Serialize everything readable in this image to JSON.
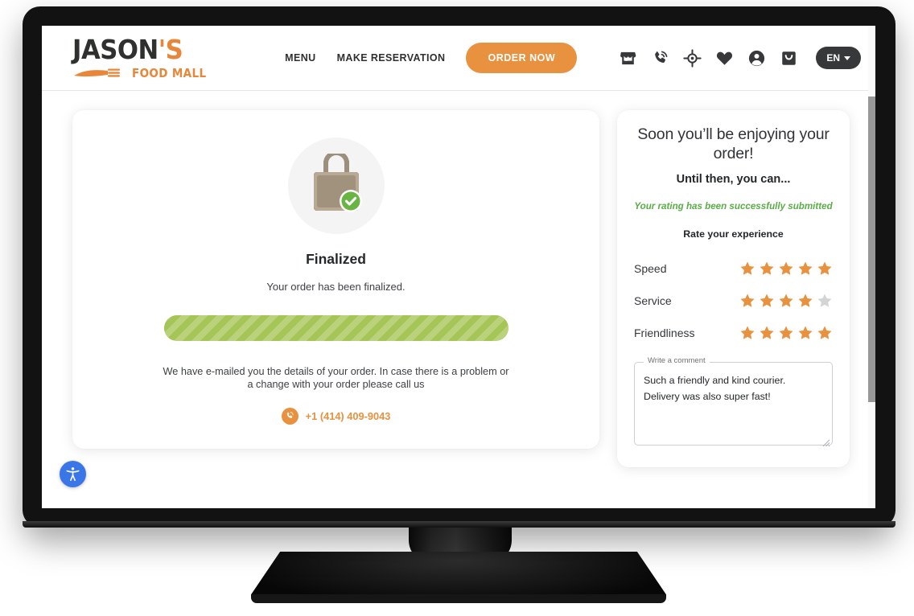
{
  "header": {
    "logo": {
      "word": "JASON",
      "apostrophe_s": "'S",
      "subtitle": "FOOD MALL"
    },
    "nav": [
      {
        "label": "MENU",
        "name": "nav-menu"
      },
      {
        "label": "MAKE RESERVATION",
        "name": "nav-make-reservation"
      }
    ],
    "order_button": "ORDER NOW",
    "icons": [
      "store-icon",
      "phone-call-icon",
      "location-target-icon",
      "heart-icon",
      "account-icon",
      "shopping-bag-icon"
    ],
    "language": {
      "label": "EN"
    }
  },
  "status": {
    "icon": "shopping-bag-check-icon",
    "title": "Finalized",
    "subtitle": "Your order has been finalized.",
    "progress_percent": 100,
    "email_note": "We have e-mailed you the details of your order. In case there is a problem or a change with your order please call us",
    "phone_icon": "phone-call-icon",
    "phone": "+1 (414) 409-9043"
  },
  "rating": {
    "heading": "Soon you’ll be enjoying your order!",
    "subheading": "Until then, you can...",
    "success_message": "Your rating has been successfully submitted",
    "section_label": "Rate your experience",
    "criteria": [
      {
        "name": "Speed",
        "value": 5,
        "max": 5
      },
      {
        "name": "Service",
        "value": 4,
        "max": 5
      },
      {
        "name": "Friendliness",
        "value": 5,
        "max": 5
      }
    ],
    "comment": {
      "legend": "Write a comment",
      "value": "Such a friendly and kind courier.\nDelivery was also super fast!",
      "placeholder": ""
    }
  },
  "accessibility": {
    "icon": "accessibility-icon"
  },
  "colors": {
    "brand_orange": "#e8913f",
    "dark": "#36383a",
    "success_green": "#5aad46",
    "progress_green": "#a6c557",
    "accessibility_blue": "#3b76e8"
  }
}
